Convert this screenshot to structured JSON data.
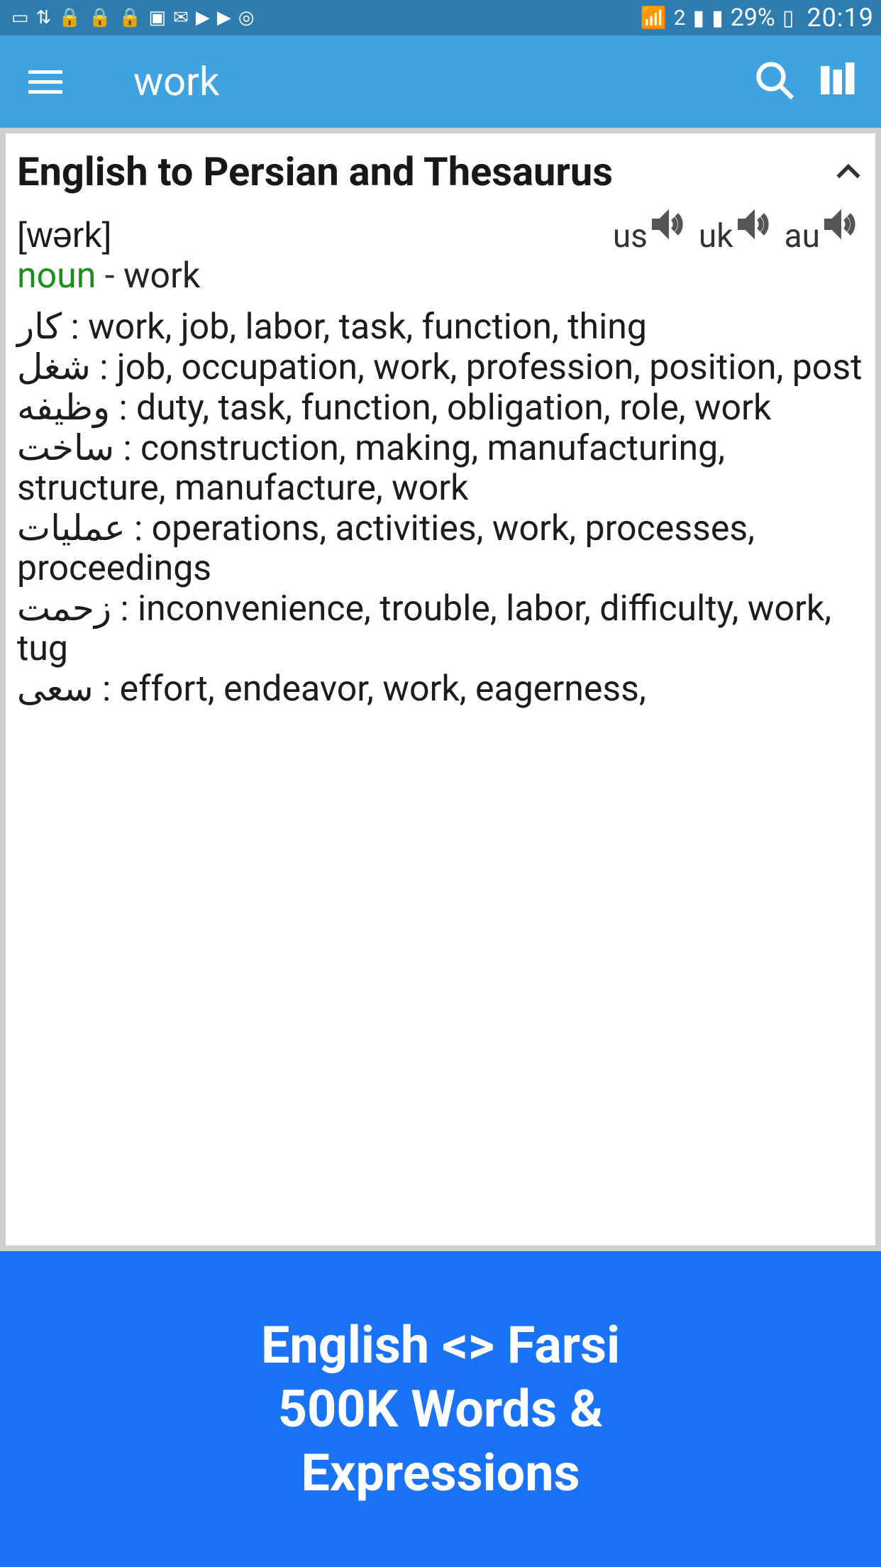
{
  "status_bar": {
    "battery_pct": "29%",
    "time": "20:19"
  },
  "app_bar": {
    "search_term": "work"
  },
  "section": {
    "title": "English to Persian and Thesaurus",
    "phonetic": "[wərk]",
    "audio": {
      "us": "us",
      "uk": "uk",
      "au": "au"
    },
    "pos": "noun",
    "dash": " - ",
    "headword": "work",
    "defs": [
      {
        "fa": "کار",
        "en": "work, job, labor, task, function, thing"
      },
      {
        "fa": "شغل",
        "en": "job, occupation, work, profession, position, post"
      },
      {
        "fa": "وظیفه",
        "en": "duty, task, function, obligation, role, work"
      },
      {
        "fa": "ساخت",
        "en": "construction, making, manufacturing, structure, manufacture, work"
      },
      {
        "fa": "عملیات",
        "en": "operations, activities, work, processes, proceedings"
      },
      {
        "fa": "زحمت",
        "en": "inconvenience, trouble, labor, difficulty, work, tug"
      },
      {
        "fa": "سعی",
        "en": "effort, endeavor, work, eagerness,"
      }
    ]
  },
  "ad": {
    "line1": "English <> Farsi",
    "line2": "500K Words &",
    "line3": "Expressions"
  }
}
